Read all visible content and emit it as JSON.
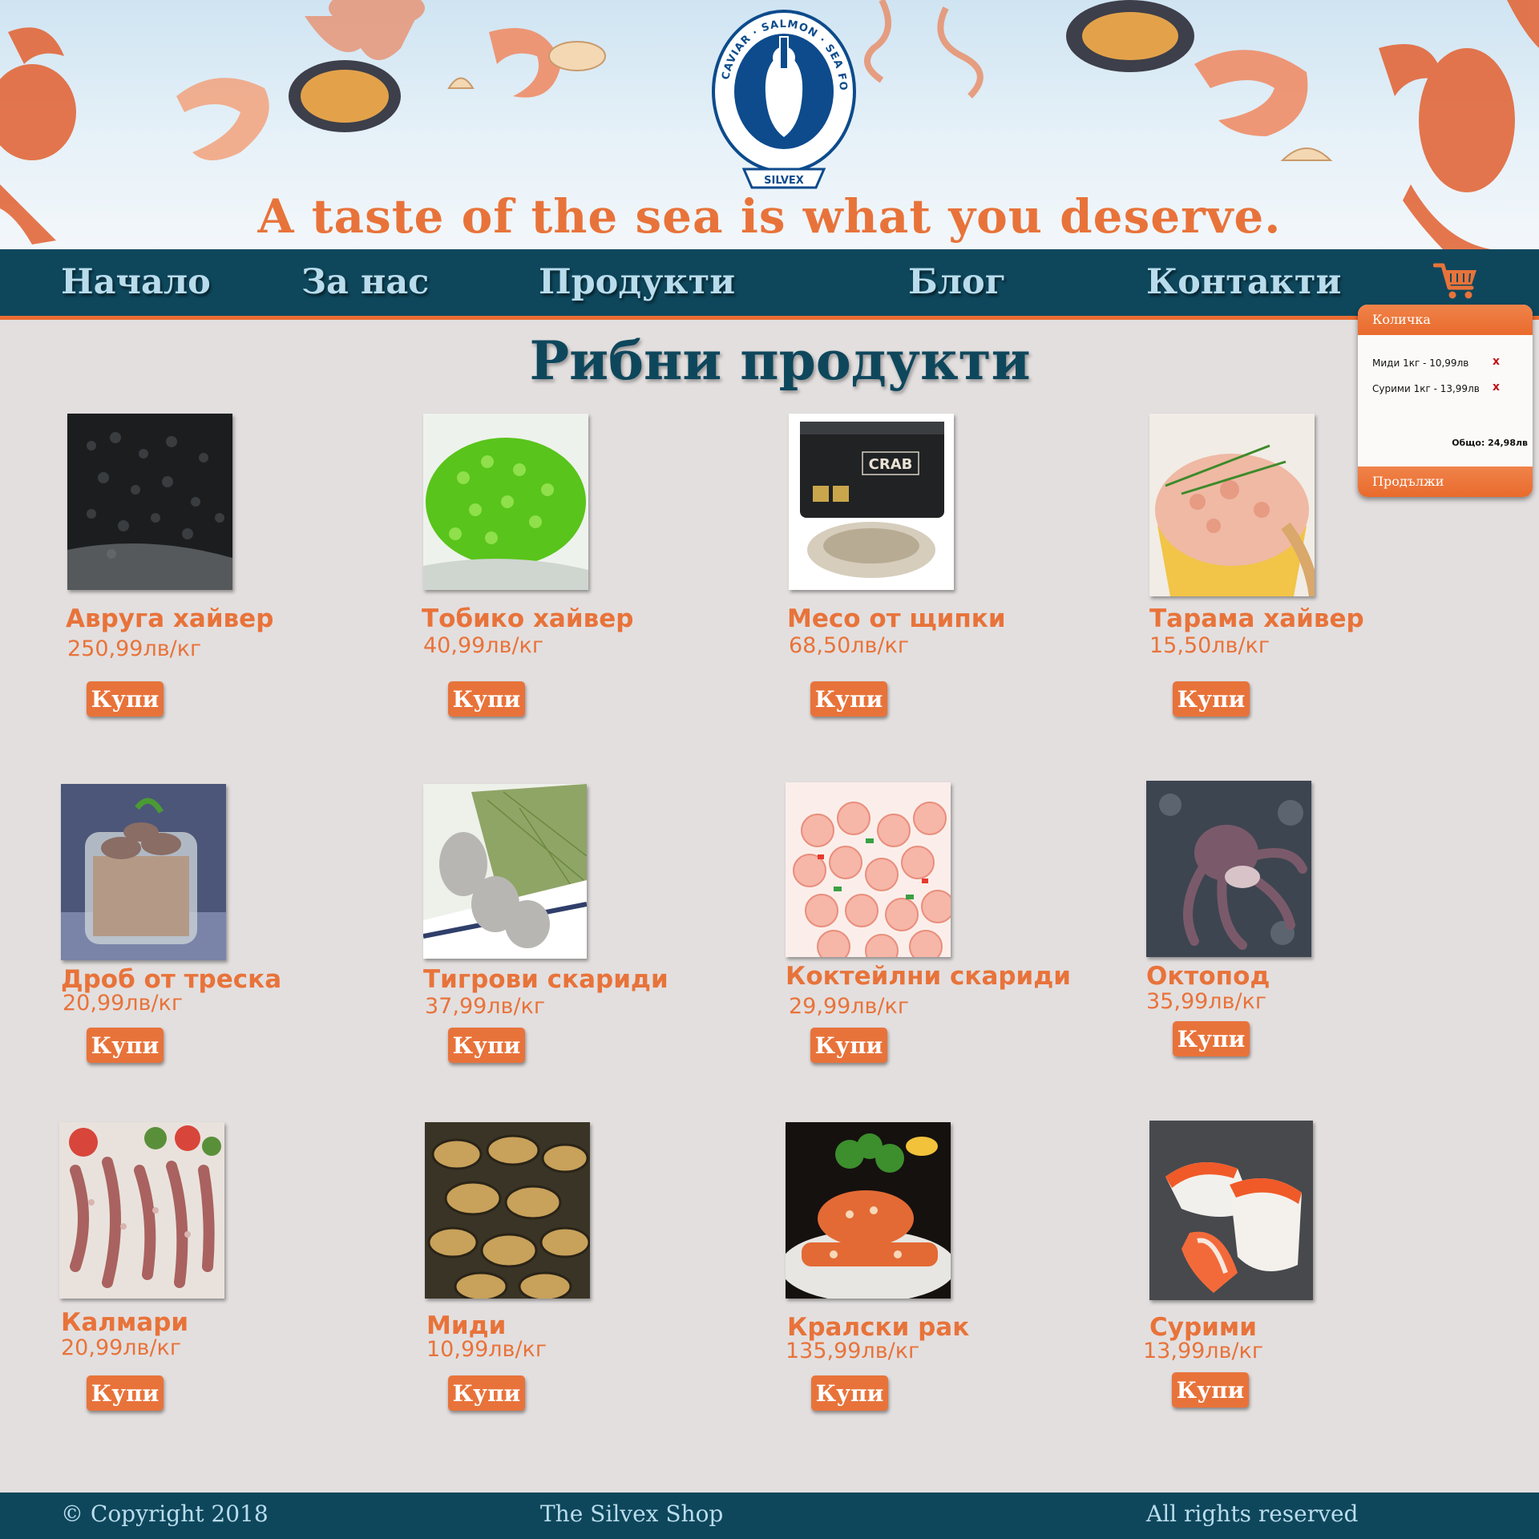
{
  "header": {
    "tagline": "A taste of the sea is what you deserve.",
    "logo": {
      "ring_top": "CAVIAR · SALMON · SEA FOOD",
      "banner": "SILVEX"
    }
  },
  "nav": {
    "items": [
      "Начало",
      "За нас",
      "Продукти",
      "Блог",
      "Контакти"
    ],
    "cart_icon": "shopping-cart-icon"
  },
  "cart": {
    "title": "Количка",
    "items": [
      {
        "label": "Миди 1кг - 10,99лв",
        "remove": "x"
      },
      {
        "label": "Сурими 1кг - 13,99лв",
        "remove": "x"
      }
    ],
    "total": "Общо: 24,98лв",
    "continue_label": "Продължи"
  },
  "main": {
    "title": "Рибни продукти",
    "buy_label": "Купи",
    "products": [
      {
        "name": "Авруга хайвер",
        "price": "250,99лв/кг",
        "image": "black-caviar"
      },
      {
        "name": "Тобико хайвер",
        "price": "40,99лв/кг",
        "image": "green-tobiko"
      },
      {
        "name": "Месо от щипки",
        "price": "68,50лв/кг",
        "image": "crab-claw-tub",
        "image_label": "CRAB"
      },
      {
        "name": "Тарама хайвер",
        "price": "15,50лв/кг",
        "image": "tarama-spread"
      },
      {
        "name": "Дроб от треска",
        "price": "20,99лв/кг",
        "image": "cod-liver-jar"
      },
      {
        "name": "Тигрови скариди",
        "price": "37,99лв/кг",
        "image": "tiger-prawns"
      },
      {
        "name": "Коктейлни скариди",
        "price": "29,99лв/кг",
        "image": "cocktail-shrimp"
      },
      {
        "name": "Октопод",
        "price": "35,99лв/кг",
        "image": "octopus"
      },
      {
        "name": "Калмари",
        "price": "20,99лв/кг",
        "image": "squid"
      },
      {
        "name": "Миди",
        "price": "10,99лв/кг",
        "image": "mussels"
      },
      {
        "name": "Кралски рак",
        "price": "135,99лв/кг",
        "image": "king-crab"
      },
      {
        "name": "Сурими",
        "price": "13,99лв/кг",
        "image": "surimi"
      }
    ]
  },
  "footer": {
    "copyright": "© Copyright 2018",
    "shop": "The Silvex Shop",
    "rights": "All rights reserved"
  },
  "colors": {
    "accent": "#e8733a",
    "nav_bg": "#0e475c",
    "nav_text": "#b9dcec",
    "page_bg": "#e3dfdf"
  }
}
